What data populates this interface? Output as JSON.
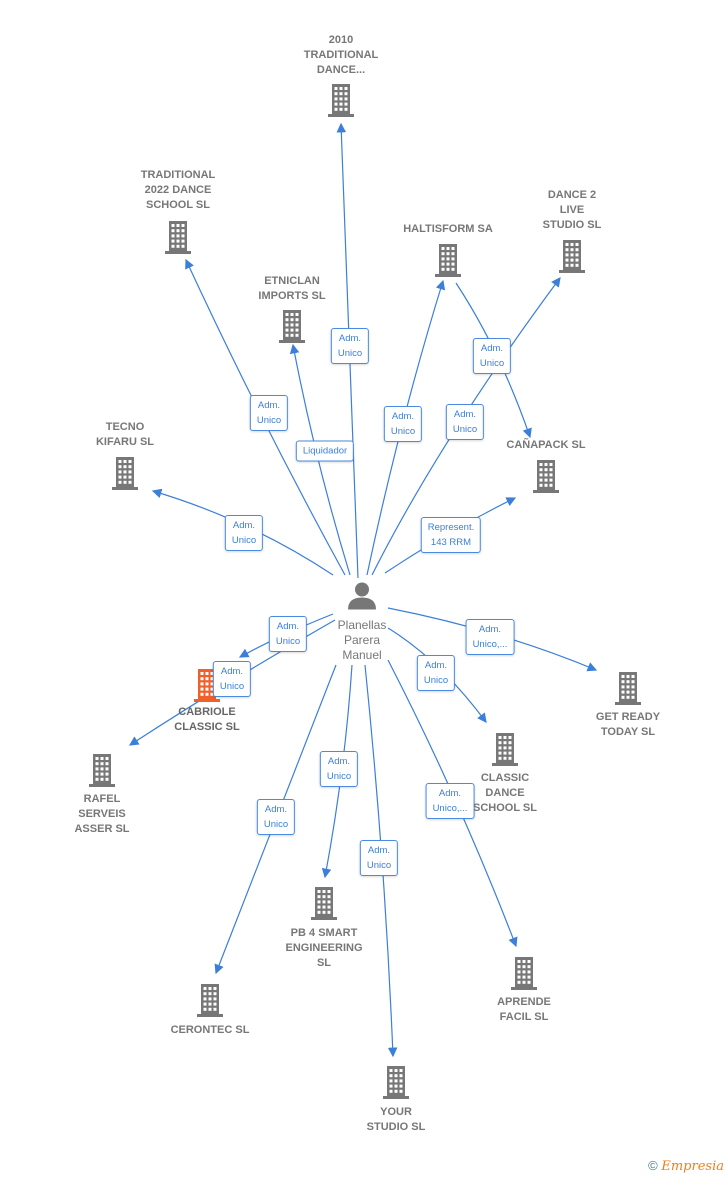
{
  "center": {
    "name_lines": [
      "Planellas",
      "Parera",
      "Manuel"
    ],
    "icon": "person-icon"
  },
  "nodes": [
    {
      "id": "n0",
      "lines": [
        "2010",
        "TRADITIONAL",
        "DANCE..."
      ]
    },
    {
      "id": "n1",
      "lines": [
        "TRADITIONAL",
        "2022 DANCE",
        "SCHOOL  SL"
      ]
    },
    {
      "id": "n2",
      "lines": [
        "ETNICLAN",
        "IMPORTS  SL"
      ]
    },
    {
      "id": "n3",
      "lines": [
        "HALTISFORM SA"
      ]
    },
    {
      "id": "n4",
      "lines": [
        "DANCE 2",
        "LIVE",
        "STUDIO  SL"
      ]
    },
    {
      "id": "n5",
      "lines": [
        "CAÑAPACK  SL"
      ]
    },
    {
      "id": "n6",
      "lines": [
        "TECNO",
        "KIFARU  SL"
      ]
    },
    {
      "id": "n7",
      "lines": [
        "CABRIOLE",
        "CLASSIC  SL"
      ],
      "highlight": true
    },
    {
      "id": "n8",
      "lines": [
        "RAFEL",
        "SERVEIS",
        "ASSER  SL"
      ]
    },
    {
      "id": "n9",
      "lines": [
        "GET READY",
        "TODAY  SL"
      ]
    },
    {
      "id": "n10",
      "lines": [
        "CLASSIC",
        "DANCE",
        "SCHOOL  SL"
      ]
    },
    {
      "id": "n11",
      "lines": [
        "APRENDE",
        "FACIL  SL"
      ]
    },
    {
      "id": "n12",
      "lines": [
        "YOUR",
        "STUDIO  SL"
      ]
    },
    {
      "id": "n13",
      "lines": [
        "PB 4 SMART",
        "ENGINEERING",
        "SL"
      ]
    },
    {
      "id": "n14",
      "lines": [
        "CERONTEC SL"
      ]
    }
  ],
  "edge_labels": [
    "Adm.\nUnico",
    "Adm.\nUnico",
    "Liquidador",
    "Adm.\nUnico",
    "Adm.\nUnico",
    "Adm.\nUnico",
    "Represent.\n143 RRM",
    "Adm.\nUnico",
    "Adm.\nUnico",
    "Adm.\nUnico",
    "Adm.\nUnico,...",
    "Adm.\nUnico",
    "Adm.\nUnico,...",
    "Adm.\nUnico",
    "Adm.\nUnico",
    "Adm.\nUnico"
  ],
  "colors": {
    "edge": "#3b7fd9",
    "building": "#777777",
    "highlight": "#f0602a",
    "text": "#777777"
  },
  "footer": {
    "copyright": "©",
    "brand": "Empresia"
  }
}
